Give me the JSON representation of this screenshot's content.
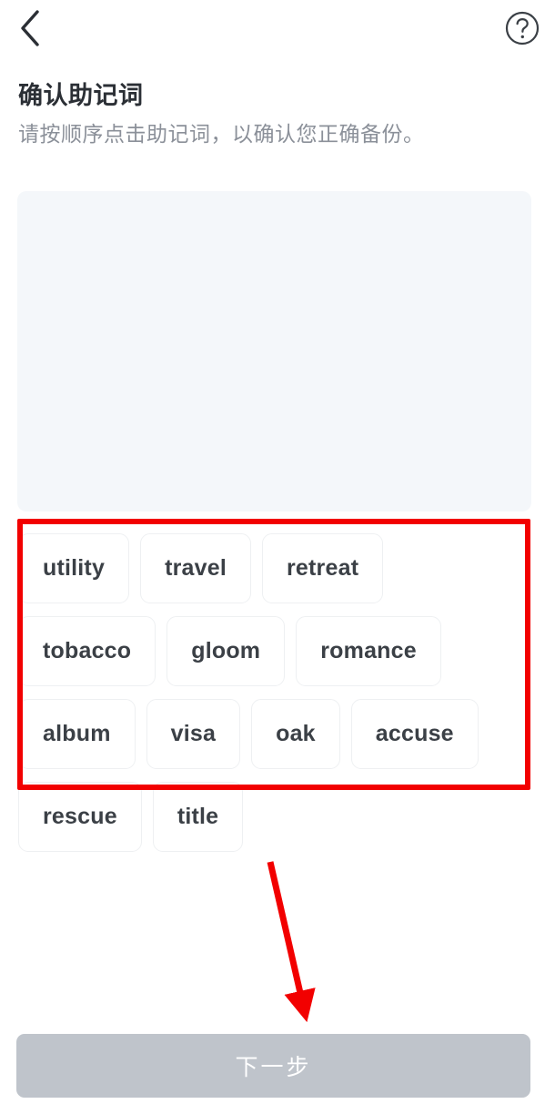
{
  "navbar": {
    "back_icon": "chevron-left-icon",
    "help_icon": "help-circle-icon"
  },
  "header": {
    "title": "确认助记词",
    "subtitle": "请按顺序点击助记词，以确认您正确备份。"
  },
  "answer_panel": {
    "selected_words": [],
    "background_color": "#f4f7fa"
  },
  "word_pool": {
    "words": [
      "utility",
      "travel",
      "retreat",
      "tobacco",
      "gloom",
      "romance",
      "album",
      "visa",
      "oak",
      "accuse",
      "rescue",
      "title"
    ]
  },
  "footer": {
    "next_label": "下一步",
    "next_enabled": false,
    "disabled_color": "#bfc4cb"
  },
  "annotations": {
    "color": "#f20000",
    "highlight_box_target": "word-pool",
    "arrow_target": "next-button"
  }
}
